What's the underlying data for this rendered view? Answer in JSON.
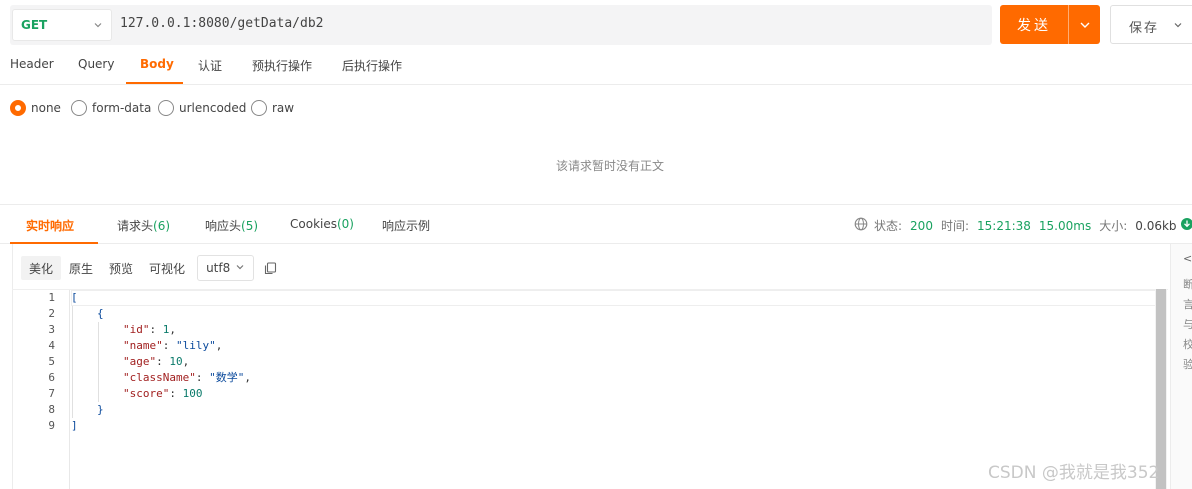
{
  "request": {
    "method": "GET",
    "url": "127.0.0.1:8080/getData/db2",
    "send_label": "发送",
    "save_label": "保存"
  },
  "request_tabs": [
    "Header",
    "Query",
    "Body",
    "认证",
    "预执行操作",
    "后执行操作"
  ],
  "active_request_tab": "Body",
  "body_types": [
    "none",
    "form-data",
    "urlencoded",
    "raw"
  ],
  "selected_body_type": "none",
  "empty_body_message": "该请求暂时没有正文",
  "response_tabs": [
    {
      "label": "实时响应",
      "count": ""
    },
    {
      "label": "请求头",
      "count": "(6)"
    },
    {
      "label": "响应头",
      "count": "(5)"
    },
    {
      "label": "Cookies",
      "count": "(0)"
    },
    {
      "label": "响应示例",
      "count": ""
    }
  ],
  "status_bar": {
    "status_label": "状态:",
    "status_value": "200",
    "time_label": "时间:",
    "time_value": "15:21:38",
    "duration": "15.00ms",
    "size_label": "大小:",
    "size_value": "0.06kb"
  },
  "response_toolbar": {
    "view_modes": [
      "美化",
      "原生",
      "预览",
      "可视化"
    ],
    "active_view": "美化",
    "encoding": "utf8"
  },
  "response_code": {
    "line_numbers": [
      "1",
      "2",
      "3",
      "4",
      "5",
      "6",
      "7",
      "8",
      "9"
    ],
    "lines": [
      "[",
      "{",
      "\"id\": 1,",
      "\"name\": \"lily\",",
      "\"age\": 10,",
      "\"className\": \"数学\",",
      "\"score\": 100",
      "}",
      "]"
    ]
  },
  "side_panel": {
    "collapse_glyph": "<<",
    "chars": [
      "断",
      "言",
      "与",
      "校",
      "验"
    ]
  },
  "watermark": "CSDN @我就是我352",
  "colors": {
    "accent": "#ff6a00",
    "success": "#1aa260"
  },
  "icons": [
    "chevron-down-icon",
    "globe-icon",
    "copy-icon",
    "download-icon"
  ]
}
